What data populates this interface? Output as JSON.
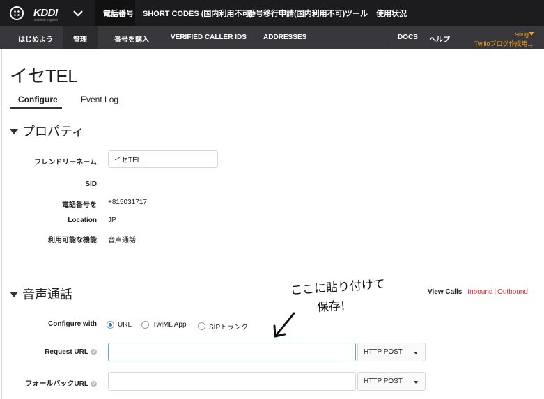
{
  "topnav": {
    "brand": "KDDI",
    "brand_sub": "Tomorrow, Together",
    "items": [
      "電話番号",
      "SHORT CODES (国内利用不可)",
      "番号移行申請(国内利用不可)",
      "ツール",
      "使用状況"
    ]
  },
  "subnav": {
    "items": [
      "はじめよう",
      "管理",
      "番号を購入",
      "VERIFIED CALLER IDS",
      "ADDRESSES"
    ],
    "docs": "DOCS",
    "help": "ヘルプ",
    "user": "song",
    "account": "Twilioブログ作成用..."
  },
  "page": {
    "title": "イセTEL",
    "tabs": [
      "Configure",
      "Event Log"
    ]
  },
  "properties": {
    "heading": "プロパティ",
    "friendly_name_label": "フレンドリーネーム",
    "friendly_name_value": "イセTEL",
    "sid_label": "SID",
    "phone_label": "電話番号を",
    "phone_value": "+815031717",
    "location_label": "Location",
    "location_value": "JP",
    "capabilities_label": "利用可能な機能",
    "capabilities_value": "音声通話"
  },
  "voice": {
    "heading": "音声通話",
    "view_calls": "View Calls",
    "inbound": "Inbound",
    "separator": "|",
    "outbound": "Outbound",
    "configure_with_label": "Configure with",
    "options": [
      "URL",
      "TwiML App",
      "SIPトランク"
    ],
    "request_url_label": "Request URL",
    "request_url_value": "",
    "request_method": "HTTP POST",
    "fallback_url_label": "フォールバックURL",
    "fallback_url_value": "",
    "fallback_method": "HTTP POST",
    "help_glyph": "?"
  },
  "annotation": {
    "line1": "ここに貼り付けて",
    "line2": "保存!"
  }
}
